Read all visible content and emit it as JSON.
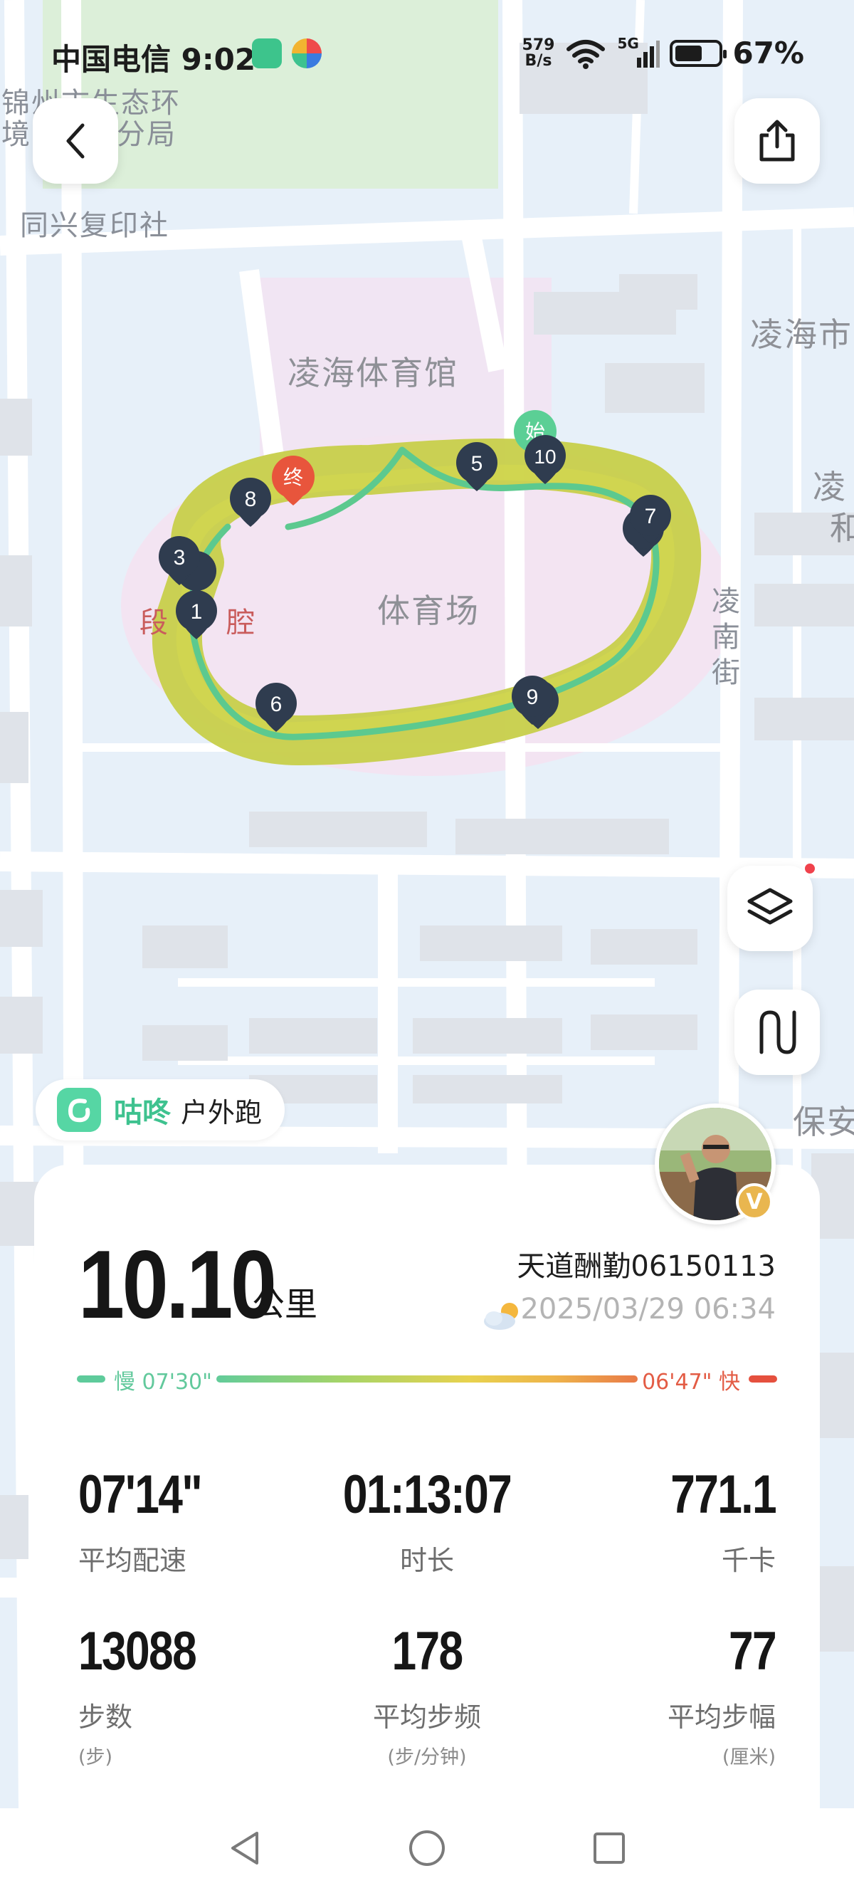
{
  "status_bar": {
    "carrier": "中国电信",
    "time": "9:02",
    "net_speed_value": "579",
    "net_speed_unit": "B/s",
    "signal_tag": "5G",
    "battery_percent": "67%",
    "battery_level": 0.67
  },
  "map": {
    "labels": {
      "top_left_line1": "锦州市生态环",
      "top_left_line2": "境",
      "top_left_line2b": "分局",
      "copy_shop": "同兴复印社",
      "gym": "凌海体育馆",
      "stadium": "体育场",
      "right_top": "凌海市",
      "right_mid_1": "凌",
      "right_mid_2": "和",
      "street": "凌南街",
      "left_red_a": "段",
      "left_red_b": "腔",
      "bottom_right": "保安"
    },
    "markers": {
      "end_label": "终",
      "start_label": "始",
      "km": [
        "1",
        "3",
        "5",
        "6",
        "7",
        "8",
        "9",
        "10"
      ]
    },
    "icons": [
      "back-arrow-icon",
      "share-icon",
      "layers-icon",
      "route-toggle-icon"
    ]
  },
  "brand": {
    "name": "咕咚",
    "sport": "户外跑"
  },
  "summary": {
    "distance": "10.10",
    "distance_unit": "公里",
    "username": "天道酬勤06150113",
    "datetime": "2025/03/29 06:34",
    "weather_icon": "partly-cloudy-icon",
    "pace_slow_label": "慢 07'30\"",
    "pace_fast_label": "06'47\" 快"
  },
  "stats": [
    {
      "value": "07'14\"",
      "label": "平均配速",
      "unit": ""
    },
    {
      "value": "01:13:07",
      "label": "时长",
      "unit": ""
    },
    {
      "value": "771.1",
      "label": "千卡",
      "unit": ""
    },
    {
      "value": "13088",
      "label": "步数",
      "unit": "(步)"
    },
    {
      "value": "178",
      "label": "平均步频",
      "unit": "(步/分钟)"
    },
    {
      "value": "77",
      "label": "平均步幅",
      "unit": "(厘米)"
    }
  ],
  "avatar_badge": "V",
  "colors": {
    "accent_green": "#3ec28f",
    "route_green": "#5cc98f",
    "route_yellow": "#c9d04a",
    "marker_dark": "#2e3b4e",
    "end_red": "#e8553c"
  }
}
